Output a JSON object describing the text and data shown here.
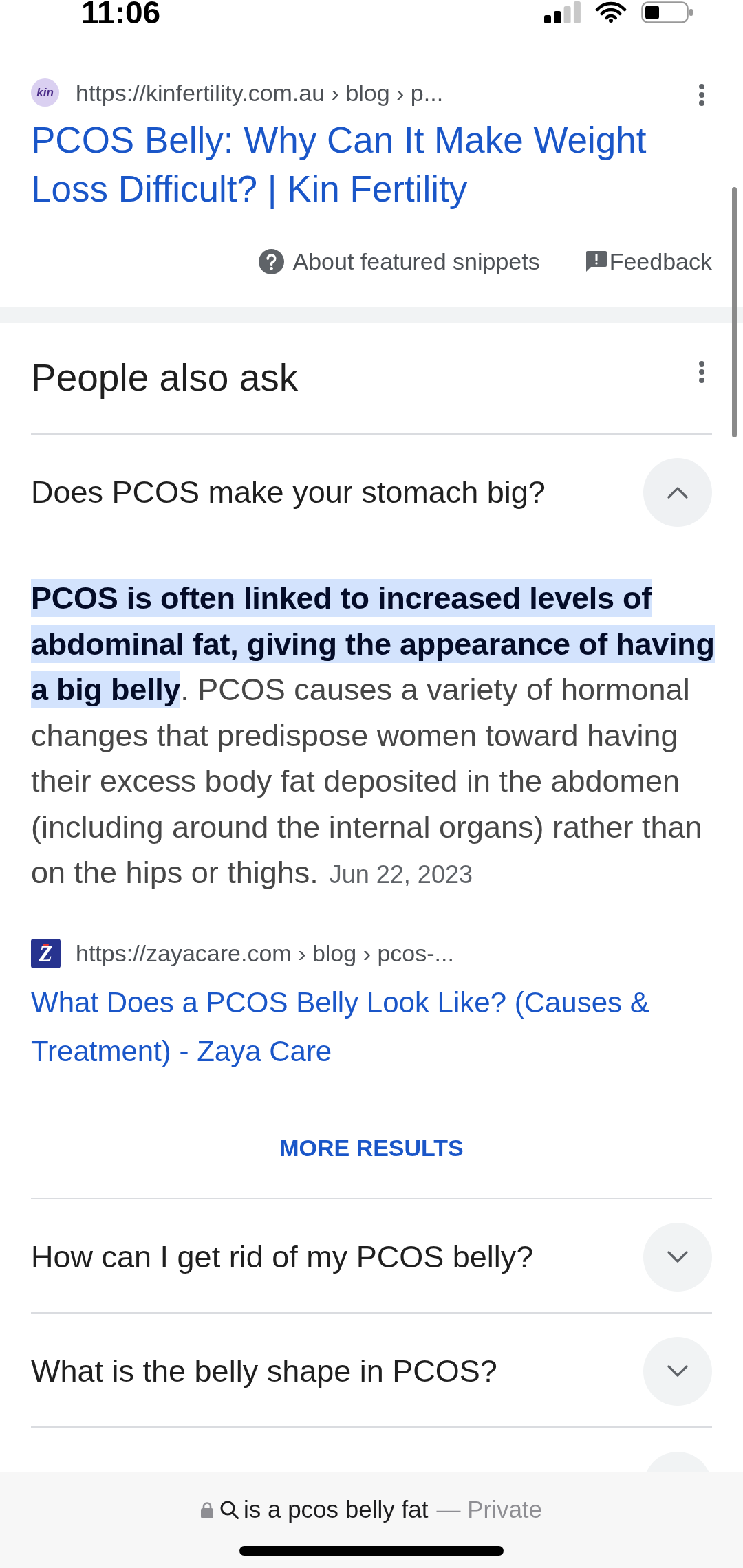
{
  "status_bar": {
    "time": "11:06"
  },
  "featured_snippet": {
    "favicon_text": "kin",
    "url": "https://kinfertility.com.au › blog › p...",
    "title": "PCOS Belly: Why Can It Make Weight Loss Difficult? | Kin Fertility",
    "about_label": "About featured snippets",
    "feedback_label": "Feedback"
  },
  "people_also_ask": {
    "heading": "People also ask",
    "questions": [
      {
        "question": "Does PCOS make your stomach big?",
        "expanded": true,
        "answer": {
          "text": "**PCOS is often linked to increased levels of abdominal fat, giving the appearance of having a big belly**. PCOS causes a variety of hormonal changes that predispose women toward having their excess body fat deposited in the abdomen (including around the internal organs) rather than on the hips or thighs.",
          "date": "Jun 22, 2023",
          "source": {
            "favicon_text": "Z",
            "url": "https://zayacare.com › blog › pcos-...",
            "title": "What Does a PCOS Belly Look Like? (Causes & Treatment) - Zaya Care"
          },
          "more_label": "MORE RESULTS"
        }
      },
      {
        "question": "How can I get rid of my PCOS belly?",
        "expanded": false
      },
      {
        "question": "What is the belly shape in PCOS?",
        "expanded": false
      }
    ]
  },
  "address_bar": {
    "query": "is a pcos belly fat",
    "mode_label": "— Private"
  }
}
